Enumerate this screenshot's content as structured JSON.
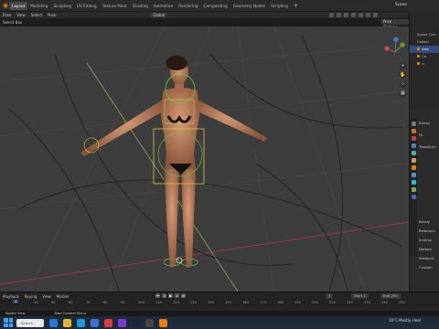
{
  "topbar": {
    "workspaces": [
      "Layout",
      "Modeling",
      "Sculpting",
      "UV Editing",
      "Texture Paint",
      "Shading",
      "Animation",
      "Rendering",
      "Compositing",
      "Geometry Nodes",
      "Scripting"
    ],
    "active_workspace": "Layout",
    "add_tab": "+",
    "scene": "Scene"
  },
  "header": {
    "mode": "Pose",
    "view": "View",
    "select": "Select",
    "pose": "Pose",
    "transform_orientation": "Global",
    "select_box": "Select Box"
  },
  "viewport": {
    "pose_options": "Pose Options",
    "tools": [
      "+",
      "✋",
      "⌕",
      "▦"
    ]
  },
  "outliner": {
    "rows": [
      "Scene Coll",
      "Collect",
      "Arm",
      "Ca",
      "Li"
    ]
  },
  "properties": {
    "rows": [
      "Bones",
      "Fk",
      "Transform",
      "Bendy",
      "Relations",
      "Inverse",
      "Deform",
      "Viewport",
      "Custom"
    ]
  },
  "timeline": {
    "playback": "Playback",
    "keying": "Keying",
    "view": "View",
    "marker": "Marker",
    "current_frame": "1",
    "start_label": "Start",
    "start_value": "1",
    "end_label": "End",
    "end_value": "250",
    "ruler": [
      "1",
      "40",
      "50",
      "60",
      "70",
      "80",
      "90",
      "100",
      "110",
      "120",
      "130",
      "140",
      "150",
      "160",
      "170",
      "180",
      "190",
      "200",
      "210",
      "220",
      "230",
      "240",
      "250"
    ]
  },
  "statusbar": {
    "rotate": "Rotate View",
    "context": "Pose Context Menu"
  },
  "taskbar": {
    "search": "Search",
    "weather": "16°C",
    "weather_desc": "Mostly clear"
  },
  "colors": {
    "accent": "#e87d0d",
    "selected": "#334d80",
    "bone_yellow": "#d9c84a",
    "bone_green": "#5fd04a"
  }
}
